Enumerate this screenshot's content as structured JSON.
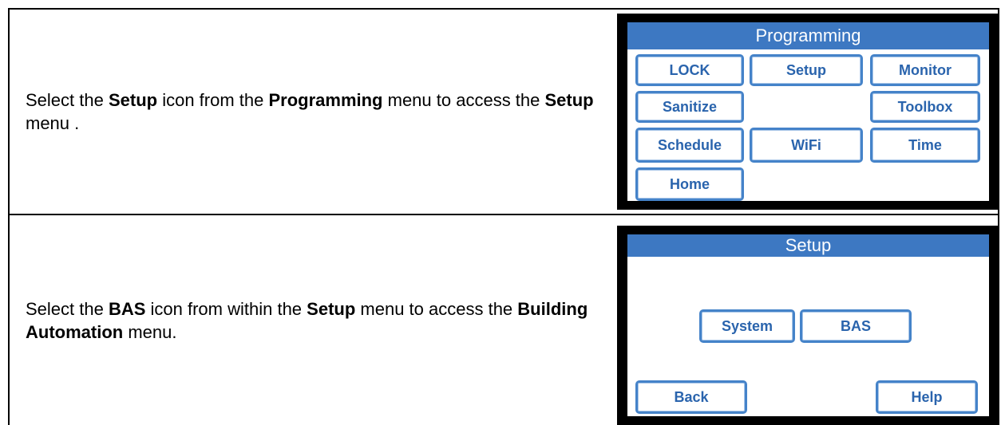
{
  "step1": {
    "text": [
      {
        "t": "Select the ",
        "b": false
      },
      {
        "t": "Setup",
        "b": true
      },
      {
        "t": " icon from the ",
        "b": false
      },
      {
        "t": "Programming",
        "b": true
      },
      {
        "t": " menu to access the ",
        "b": false
      },
      {
        "t": "Setup",
        "b": true
      },
      {
        "t": " menu .",
        "b": false
      }
    ],
    "screen": {
      "title": "Programming",
      "buttons": {
        "lock": "LOCK",
        "setup": "Setup",
        "monitor": "Monitor",
        "sanitize": "Sanitize",
        "toolbox": "Toolbox",
        "schedule": "Schedule",
        "wifi": "WiFi",
        "time": "Time",
        "home": "Home"
      }
    }
  },
  "step2": {
    "text": [
      {
        "t": "Select the ",
        "b": false
      },
      {
        "t": "BAS",
        "b": true
      },
      {
        "t": " icon from within the ",
        "b": false
      },
      {
        "t": "Setup",
        "b": true
      },
      {
        "t": " menu to access the ",
        "b": false
      },
      {
        "t": "Building Automation",
        "b": true
      },
      {
        "t": " menu.",
        "b": false
      }
    ],
    "screen": {
      "title": "Setup",
      "buttons": {
        "system": "System",
        "bas": "BAS",
        "back": "Back",
        "help": "Help"
      }
    }
  },
  "colors": {
    "title_bar": "#3d78c2",
    "button_border": "#4583c9",
    "button_text": "#2a64ad"
  }
}
